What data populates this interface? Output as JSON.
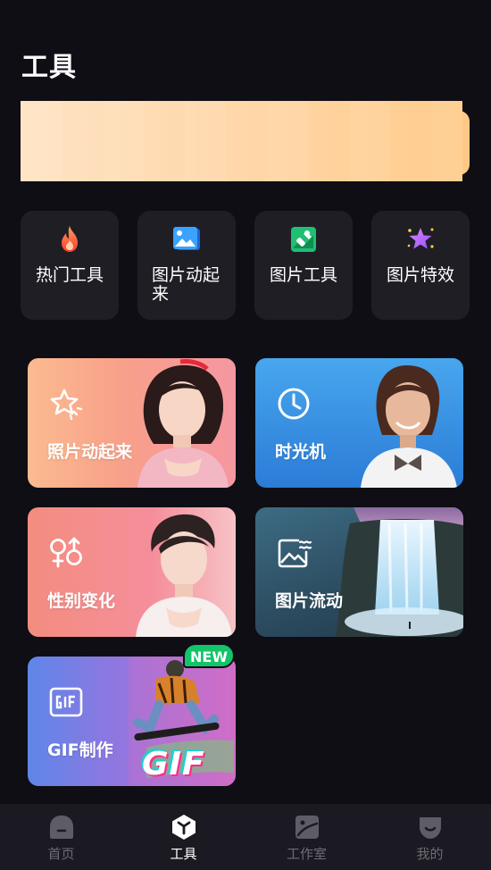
{
  "header": {
    "title": "工具"
  },
  "categories": [
    {
      "label": "热门工具",
      "icon": "flame-icon"
    },
    {
      "label": "图片动起来",
      "icon": "image-animate-icon"
    },
    {
      "label": "图片工具",
      "icon": "image-tool-icon"
    },
    {
      "label": "图片特效",
      "icon": "star-effect-icon"
    }
  ],
  "features": [
    {
      "label": "照片动起来",
      "icon": "sparkle-star-icon"
    },
    {
      "label": "时光机",
      "icon": "clock-icon"
    },
    {
      "label": "性别变化",
      "icon": "gender-icon"
    },
    {
      "label": "图片流动",
      "icon": "image-flow-icon"
    },
    {
      "label": "GIF制作",
      "icon": "gif-icon",
      "badge": "NEW",
      "art_text": "GIF"
    }
  ],
  "tabbar": {
    "items": [
      {
        "label": "首页",
        "icon": "home-icon",
        "active": false
      },
      {
        "label": "工具",
        "icon": "tools-cube-icon",
        "active": true
      },
      {
        "label": "工作室",
        "icon": "studio-icon",
        "active": false
      },
      {
        "label": "我的",
        "icon": "profile-icon",
        "active": false
      }
    ]
  },
  "colors": {
    "background": "#0f0e14",
    "card_dark": "#1f1e25",
    "badge_green": "#13c46a",
    "banner": "#ffd8ab"
  }
}
